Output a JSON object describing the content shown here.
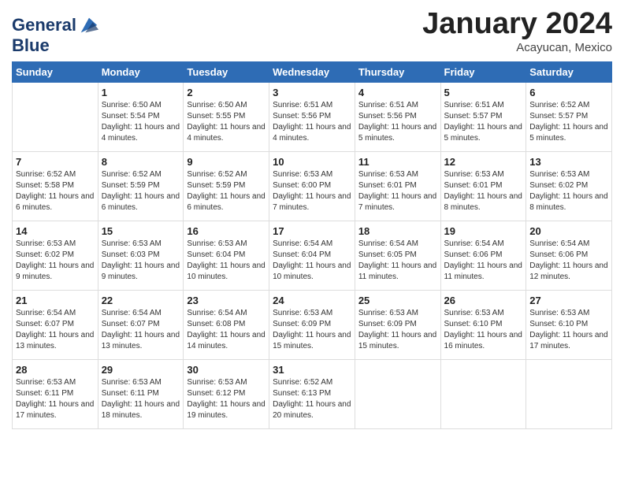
{
  "header": {
    "logo_line1": "General",
    "logo_line2": "Blue",
    "month": "January 2024",
    "location": "Acayucan, Mexico"
  },
  "days_of_week": [
    "Sunday",
    "Monday",
    "Tuesday",
    "Wednesday",
    "Thursday",
    "Friday",
    "Saturday"
  ],
  "weeks": [
    [
      {
        "day": "",
        "sunrise": "",
        "sunset": "",
        "daylight": ""
      },
      {
        "day": "1",
        "sunrise": "Sunrise: 6:50 AM",
        "sunset": "Sunset: 5:54 PM",
        "daylight": "Daylight: 11 hours and 4 minutes."
      },
      {
        "day": "2",
        "sunrise": "Sunrise: 6:50 AM",
        "sunset": "Sunset: 5:55 PM",
        "daylight": "Daylight: 11 hours and 4 minutes."
      },
      {
        "day": "3",
        "sunrise": "Sunrise: 6:51 AM",
        "sunset": "Sunset: 5:56 PM",
        "daylight": "Daylight: 11 hours and 4 minutes."
      },
      {
        "day": "4",
        "sunrise": "Sunrise: 6:51 AM",
        "sunset": "Sunset: 5:56 PM",
        "daylight": "Daylight: 11 hours and 5 minutes."
      },
      {
        "day": "5",
        "sunrise": "Sunrise: 6:51 AM",
        "sunset": "Sunset: 5:57 PM",
        "daylight": "Daylight: 11 hours and 5 minutes."
      },
      {
        "day": "6",
        "sunrise": "Sunrise: 6:52 AM",
        "sunset": "Sunset: 5:57 PM",
        "daylight": "Daylight: 11 hours and 5 minutes."
      }
    ],
    [
      {
        "day": "7",
        "sunrise": "Sunrise: 6:52 AM",
        "sunset": "Sunset: 5:58 PM",
        "daylight": "Daylight: 11 hours and 6 minutes."
      },
      {
        "day": "8",
        "sunrise": "Sunrise: 6:52 AM",
        "sunset": "Sunset: 5:59 PM",
        "daylight": "Daylight: 11 hours and 6 minutes."
      },
      {
        "day": "9",
        "sunrise": "Sunrise: 6:52 AM",
        "sunset": "Sunset: 5:59 PM",
        "daylight": "Daylight: 11 hours and 6 minutes."
      },
      {
        "day": "10",
        "sunrise": "Sunrise: 6:53 AM",
        "sunset": "Sunset: 6:00 PM",
        "daylight": "Daylight: 11 hours and 7 minutes."
      },
      {
        "day": "11",
        "sunrise": "Sunrise: 6:53 AM",
        "sunset": "Sunset: 6:01 PM",
        "daylight": "Daylight: 11 hours and 7 minutes."
      },
      {
        "day": "12",
        "sunrise": "Sunrise: 6:53 AM",
        "sunset": "Sunset: 6:01 PM",
        "daylight": "Daylight: 11 hours and 8 minutes."
      },
      {
        "day": "13",
        "sunrise": "Sunrise: 6:53 AM",
        "sunset": "Sunset: 6:02 PM",
        "daylight": "Daylight: 11 hours and 8 minutes."
      }
    ],
    [
      {
        "day": "14",
        "sunrise": "Sunrise: 6:53 AM",
        "sunset": "Sunset: 6:02 PM",
        "daylight": "Daylight: 11 hours and 9 minutes."
      },
      {
        "day": "15",
        "sunrise": "Sunrise: 6:53 AM",
        "sunset": "Sunset: 6:03 PM",
        "daylight": "Daylight: 11 hours and 9 minutes."
      },
      {
        "day": "16",
        "sunrise": "Sunrise: 6:53 AM",
        "sunset": "Sunset: 6:04 PM",
        "daylight": "Daylight: 11 hours and 10 minutes."
      },
      {
        "day": "17",
        "sunrise": "Sunrise: 6:54 AM",
        "sunset": "Sunset: 6:04 PM",
        "daylight": "Daylight: 11 hours and 10 minutes."
      },
      {
        "day": "18",
        "sunrise": "Sunrise: 6:54 AM",
        "sunset": "Sunset: 6:05 PM",
        "daylight": "Daylight: 11 hours and 11 minutes."
      },
      {
        "day": "19",
        "sunrise": "Sunrise: 6:54 AM",
        "sunset": "Sunset: 6:06 PM",
        "daylight": "Daylight: 11 hours and 11 minutes."
      },
      {
        "day": "20",
        "sunrise": "Sunrise: 6:54 AM",
        "sunset": "Sunset: 6:06 PM",
        "daylight": "Daylight: 11 hours and 12 minutes."
      }
    ],
    [
      {
        "day": "21",
        "sunrise": "Sunrise: 6:54 AM",
        "sunset": "Sunset: 6:07 PM",
        "daylight": "Daylight: 11 hours and 13 minutes."
      },
      {
        "day": "22",
        "sunrise": "Sunrise: 6:54 AM",
        "sunset": "Sunset: 6:07 PM",
        "daylight": "Daylight: 11 hours and 13 minutes."
      },
      {
        "day": "23",
        "sunrise": "Sunrise: 6:54 AM",
        "sunset": "Sunset: 6:08 PM",
        "daylight": "Daylight: 11 hours and 14 minutes."
      },
      {
        "day": "24",
        "sunrise": "Sunrise: 6:53 AM",
        "sunset": "Sunset: 6:09 PM",
        "daylight": "Daylight: 11 hours and 15 minutes."
      },
      {
        "day": "25",
        "sunrise": "Sunrise: 6:53 AM",
        "sunset": "Sunset: 6:09 PM",
        "daylight": "Daylight: 11 hours and 15 minutes."
      },
      {
        "day": "26",
        "sunrise": "Sunrise: 6:53 AM",
        "sunset": "Sunset: 6:10 PM",
        "daylight": "Daylight: 11 hours and 16 minutes."
      },
      {
        "day": "27",
        "sunrise": "Sunrise: 6:53 AM",
        "sunset": "Sunset: 6:10 PM",
        "daylight": "Daylight: 11 hours and 17 minutes."
      }
    ],
    [
      {
        "day": "28",
        "sunrise": "Sunrise: 6:53 AM",
        "sunset": "Sunset: 6:11 PM",
        "daylight": "Daylight: 11 hours and 17 minutes."
      },
      {
        "day": "29",
        "sunrise": "Sunrise: 6:53 AM",
        "sunset": "Sunset: 6:11 PM",
        "daylight": "Daylight: 11 hours and 18 minutes."
      },
      {
        "day": "30",
        "sunrise": "Sunrise: 6:53 AM",
        "sunset": "Sunset: 6:12 PM",
        "daylight": "Daylight: 11 hours and 19 minutes."
      },
      {
        "day": "31",
        "sunrise": "Sunrise: 6:52 AM",
        "sunset": "Sunset: 6:13 PM",
        "daylight": "Daylight: 11 hours and 20 minutes."
      },
      {
        "day": "",
        "sunrise": "",
        "sunset": "",
        "daylight": ""
      },
      {
        "day": "",
        "sunrise": "",
        "sunset": "",
        "daylight": ""
      },
      {
        "day": "",
        "sunrise": "",
        "sunset": "",
        "daylight": ""
      }
    ]
  ]
}
